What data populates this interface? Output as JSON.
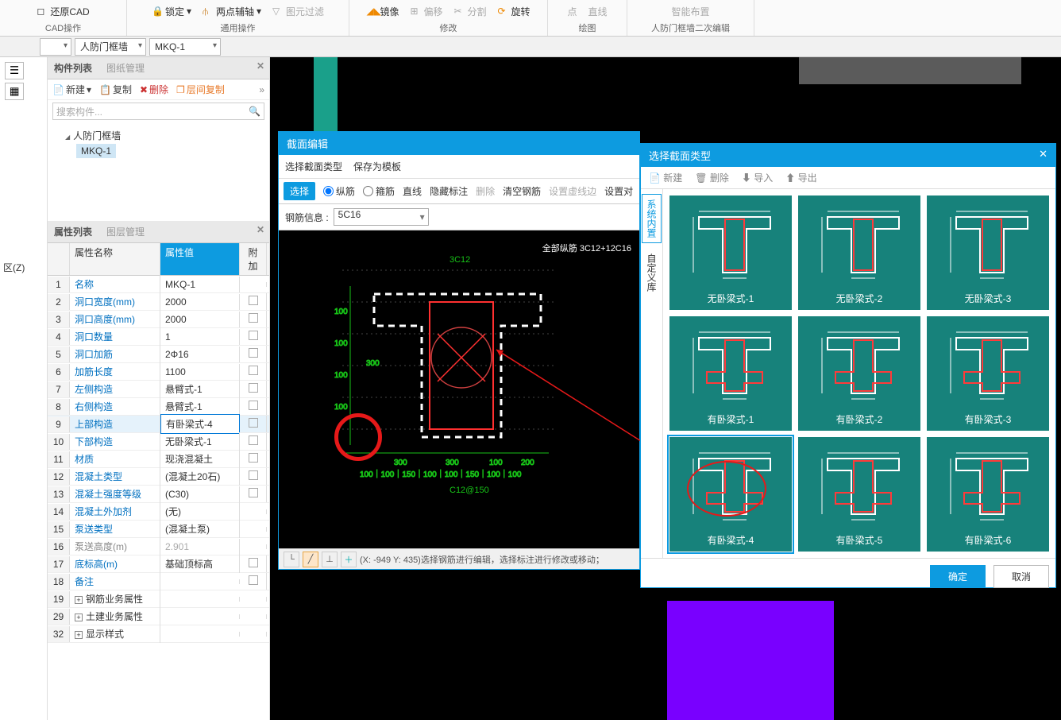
{
  "ribbon": {
    "restore_cad": "还原CAD",
    "cad_ops": "CAD操作",
    "lock": "锁定",
    "two_point_axis": "两点辅轴",
    "elem_filter": "图元过滤",
    "general_ops": "通用操作",
    "mirror": "镜像",
    "offset": "偏移",
    "split": "分割",
    "rotate": "旋转",
    "modify": "修改",
    "point": "点",
    "line": "直线",
    "smart_layout": "智能布置",
    "draw": "绘图",
    "secondary_edit": "人防门框墙二次编辑"
  },
  "dropdowns": {
    "category": "人防门框墙",
    "component": "MKQ-1"
  },
  "left_panel": {
    "tab1": "构件列表",
    "tab2": "图纸管理",
    "new": "新建",
    "copy": "复制",
    "delete": "删除",
    "layer_copy": "层间复制",
    "search_ph": "搜索构件...",
    "tree_parent": "人防门框墙",
    "tree_child": "MKQ-1"
  },
  "prop_panel": {
    "tab1": "属性列表",
    "tab2": "图层管理",
    "col_name": "属性名称",
    "col_val": "属性值",
    "col_extra": "附加",
    "rows": [
      {
        "n": "1",
        "name": "名称",
        "val": "MKQ-1",
        "blue": true
      },
      {
        "n": "2",
        "name": "洞口宽度(mm)",
        "val": "2000",
        "blue": true,
        "chk": true
      },
      {
        "n": "3",
        "name": "洞口高度(mm)",
        "val": "2000",
        "blue": true,
        "chk": true
      },
      {
        "n": "4",
        "name": "洞口数量",
        "val": "1",
        "blue": true,
        "chk": true
      },
      {
        "n": "5",
        "name": "洞口加筋",
        "val": "2Φ16",
        "blue": true,
        "chk": true
      },
      {
        "n": "6",
        "name": "加筋长度",
        "val": "1100",
        "blue": true,
        "chk": true
      },
      {
        "n": "7",
        "name": "左侧构造",
        "val": "悬臂式-1",
        "blue": true,
        "chk": true
      },
      {
        "n": "8",
        "name": "右侧构造",
        "val": "悬臂式-1",
        "blue": true,
        "chk": true
      },
      {
        "n": "9",
        "name": "上部构造",
        "val": "有卧梁式-4",
        "blue": true,
        "chk": true,
        "sel": true
      },
      {
        "n": "10",
        "name": "下部构造",
        "val": "无卧梁式-1",
        "blue": true,
        "chk": true
      },
      {
        "n": "11",
        "name": "材质",
        "val": "现浇混凝土",
        "blue": true,
        "chk": true
      },
      {
        "n": "12",
        "name": "混凝土类型",
        "val": "(混凝土20石)",
        "blue": true,
        "chk": true
      },
      {
        "n": "13",
        "name": "混凝土强度等级",
        "val": "(C30)",
        "blue": true,
        "chk": true
      },
      {
        "n": "14",
        "name": "混凝土外加剂",
        "val": "(无)",
        "blue": true
      },
      {
        "n": "15",
        "name": "泵送类型",
        "val": "(混凝土泵)",
        "blue": true
      },
      {
        "n": "16",
        "name": "泵送高度(m)",
        "val": "2.901",
        "gray": true
      },
      {
        "n": "17",
        "name": "底标高(m)",
        "val": "基础顶标高",
        "blue": true,
        "chk": true
      },
      {
        "n": "18",
        "name": "备注",
        "val": "",
        "blue": true,
        "chk": true
      },
      {
        "n": "19",
        "name": "钢筋业务属性",
        "val": "",
        "plus": true
      },
      {
        "n": "29",
        "name": "土建业务属性",
        "val": "",
        "plus": true
      },
      {
        "n": "32",
        "name": "显示样式",
        "val": "",
        "plus": true
      }
    ]
  },
  "left_misc": {
    "region_z": "区(Z)"
  },
  "sec_editor": {
    "title": "截面编辑",
    "select_type": "选择截面类型",
    "save_template": "保存为模板",
    "btn_select": "选择",
    "rb_long": "纵筋",
    "rb_stirrup": "箍筋",
    "line": "直线",
    "hide_label": "隐藏标注",
    "del": "删除",
    "clear": "清空钢筋",
    "dashed_edge": "设置虚线边",
    "set_pair": "设置对",
    "info_label": "钢筋信息 :",
    "info_value": "5C16",
    "status": "(X: -949 Y: 435)选择钢筋进行编辑，选择标注进行修改或移动；",
    "rebar_label": "全部纵筋  3C12+12C16"
  },
  "type_selector": {
    "title": "选择截面类型",
    "close": "✕",
    "new": "新建",
    "delete": "删除",
    "import": "导入",
    "export": "导出",
    "vtab1": "系统内置",
    "vtab2": "自定义库",
    "items": [
      "无卧梁式-1",
      "无卧梁式-2",
      "无卧梁式-3",
      "有卧梁式-1",
      "有卧梁式-2",
      "有卧梁式-3",
      "有卧梁式-4",
      "有卧梁式-5",
      "有卧梁式-6"
    ],
    "ok": "确定",
    "cancel": "取消"
  }
}
